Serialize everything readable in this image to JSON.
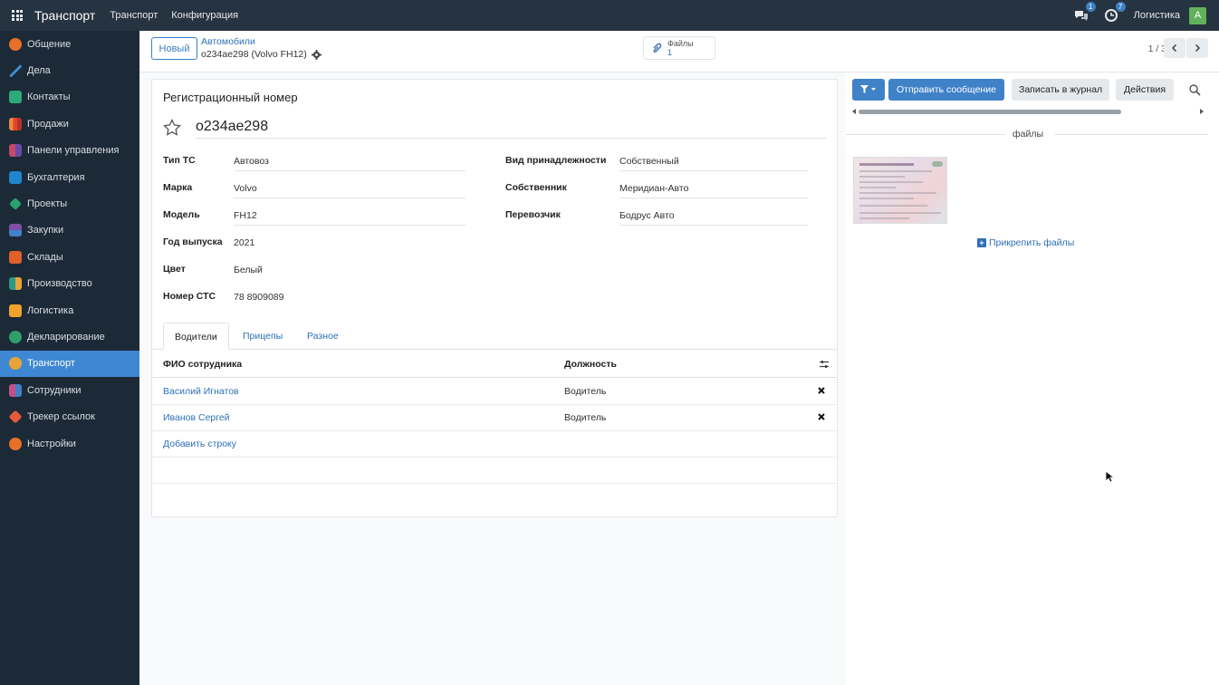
{
  "topbar": {
    "app_title": "Транспорт",
    "menu": [
      "Транспорт",
      "Конфигурация"
    ],
    "messages_badge": "1",
    "activities_badge": "7",
    "user_name": "Логистика",
    "avatar_letter": "A"
  },
  "sidebar": {
    "items": [
      {
        "label": "Общение",
        "icon": "chat-icon",
        "color": "#e8702a"
      },
      {
        "label": "Дела",
        "icon": "pen-icon",
        "color": "#3a8fd6"
      },
      {
        "label": "Контакты",
        "icon": "contacts-icon",
        "color": "#2ea97a"
      },
      {
        "label": "Продажи",
        "icon": "sales-icon",
        "color": "#e2452b"
      },
      {
        "label": "Панели управления",
        "icon": "dashboard-icon",
        "color": "#c24a6a"
      },
      {
        "label": "Бухгалтерия",
        "icon": "accounting-icon",
        "color": "#1f86cf"
      },
      {
        "label": "Проекты",
        "icon": "projects-icon",
        "color": "#25a36a"
      },
      {
        "label": "Закупки",
        "icon": "purchase-icon",
        "color": "#7e4ea8"
      },
      {
        "label": "Склады",
        "icon": "inventory-icon",
        "color": "#e0602a"
      },
      {
        "label": "Производство",
        "icon": "manufacturing-icon",
        "color": "#2c9a8a"
      },
      {
        "label": "Логистика",
        "icon": "logistics-icon",
        "color": "#f2a22a"
      },
      {
        "label": "Декларирование",
        "icon": "declaration-icon",
        "color": "#2f9e6a"
      },
      {
        "label": "Транспорт",
        "icon": "transport-icon",
        "color": "#e8a43a",
        "active": true
      },
      {
        "label": "Сотрудники",
        "icon": "employees-icon",
        "color": "#c4508a"
      },
      {
        "label": "Трекер ссылок",
        "icon": "link-tracker-icon",
        "color": "#e65a3a"
      },
      {
        "label": "Настройки",
        "icon": "settings-icon",
        "color": "#e8702a"
      }
    ]
  },
  "control_panel": {
    "new_label": "Новый",
    "breadcrumb_parent": "Автомобили",
    "breadcrumb_current": "о234ае298 (Volvo FH12)",
    "files_label": "Файлы",
    "files_count": "1",
    "pager": "1 / 3"
  },
  "form": {
    "reg_title": "Регистрационный номер",
    "plate": "о234ае298",
    "fields_left": [
      {
        "label": "Тип ТС",
        "value": "Автовоз"
      },
      {
        "label": "Марка",
        "value": "Volvo"
      },
      {
        "label": "Модель",
        "value": "FH12"
      },
      {
        "label": "Год выпуска",
        "value": "2021"
      },
      {
        "label": "Цвет",
        "value": "Белый"
      },
      {
        "label": "Номер СТС",
        "value": "78 8909089"
      }
    ],
    "fields_right": [
      {
        "label": "Вид принадлежности",
        "value": "Собственный"
      },
      {
        "label": "Собственник",
        "value": "Меридиан-Авто"
      },
      {
        "label": "Перевозчик",
        "value": "Бодрус Авто"
      }
    ],
    "tabs": [
      "Водители",
      "Прицепы",
      "Разное"
    ],
    "table": {
      "columns": [
        "ФИО сотрудника",
        "Должность"
      ],
      "rows": [
        {
          "name": "Василий Игнатов",
          "position": "Водитель"
        },
        {
          "name": "Иванов Сергей",
          "position": "Водитель"
        }
      ],
      "add_row": "Добавить строку"
    }
  },
  "chatter": {
    "send_message": "Отправить сообщение",
    "log_note": "Записать в журнал",
    "actions": "Действия",
    "files_header": "файлы",
    "attach_files": "Прикрепить файлы"
  }
}
